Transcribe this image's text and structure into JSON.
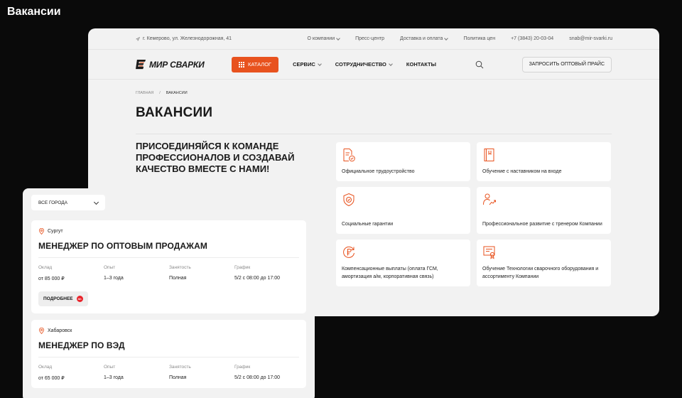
{
  "page_heading": "Вакансии",
  "topbar": {
    "address": "г. Кемерово, ул. Железнодорожная, 41",
    "links": [
      {
        "label": "О компании",
        "dropdown": true
      },
      {
        "label": "Пресс-центр",
        "dropdown": false
      },
      {
        "label": "Доставка и оплата",
        "dropdown": true
      },
      {
        "label": "Политика цен",
        "dropdown": false
      }
    ],
    "phone": "+7 (3843) 20-03-04",
    "email": "snab@mir-svarki.ru"
  },
  "navbar": {
    "logo_text": "МИР СВАРКИ",
    "catalog_label": "КАТАЛОГ",
    "menu": [
      {
        "label": "СЕРВИС",
        "dropdown": true
      },
      {
        "label": "СОТРУДНИЧЕСТВО",
        "dropdown": true
      },
      {
        "label": "КОНТАКТЫ",
        "dropdown": false
      }
    ],
    "price_button": "ЗАПРОСИТЬ ОПТОВЫЙ ПРАЙС"
  },
  "breadcrumbs": {
    "home": "ГЛАВНАЯ",
    "separator": "/",
    "current": "ВАКАНСИИ"
  },
  "title": "ВАКАНСИИ",
  "intro": "ПРИСОЕДИНЯЙСЯ К КОМАНДЕ ПРОФЕССИОНАЛОВ И СОЗДАВАЙ КАЧЕСТВО ВМЕСТЕ С НАМИ!",
  "benefits": [
    {
      "text": "Официальное трудоустройство",
      "icon": "document-check-icon"
    },
    {
      "text": "Обучение с наставником на входе",
      "icon": "book-icon"
    },
    {
      "text": "Социальные гарантии",
      "icon": "shield-check-icon"
    },
    {
      "text": "Профессиональное развитие с тренером Компании",
      "icon": "person-growth-icon"
    },
    {
      "text": "Компенсационные выплаты (оплата ГСМ, амортизация а/м, корпоративная связь)",
      "icon": "ruble-cycle-icon"
    },
    {
      "text": "Обучение Технологии сварочного оборудования и ассортименту Компании",
      "icon": "certificate-icon"
    }
  ],
  "filter": {
    "city_select": "ВСЕ ГОРОДА"
  },
  "jobs": [
    {
      "city": "Сургут",
      "title": "МЕНЕДЖЕР ПО ОПТОВЫМ ПРОДАЖАМ",
      "labels": {
        "salary": "Оклад",
        "experience": "Опыт",
        "employment": "Занятость",
        "schedule": "График"
      },
      "salary": "от 85 000 ₽",
      "experience": "1–3 года",
      "employment": "Полная",
      "schedule": "5/2 с 08:00 до 17:00",
      "more_label": "ПОДРОБНЕЕ"
    },
    {
      "city": "Хабаровск",
      "title": "МЕНЕДЖЕР ПО ВЭД",
      "labels": {
        "salary": "Оклад",
        "experience": "Опыт",
        "employment": "Занятость",
        "schedule": "График"
      },
      "salary": "от 65 000 ₽",
      "experience": "1–3 года",
      "employment": "Полная",
      "schedule": "5/2 с 08:00 до 17:00"
    }
  ],
  "colors": {
    "accent": "#e8521e",
    "background": "#0a0a0a",
    "panel": "#f2f2f2"
  }
}
